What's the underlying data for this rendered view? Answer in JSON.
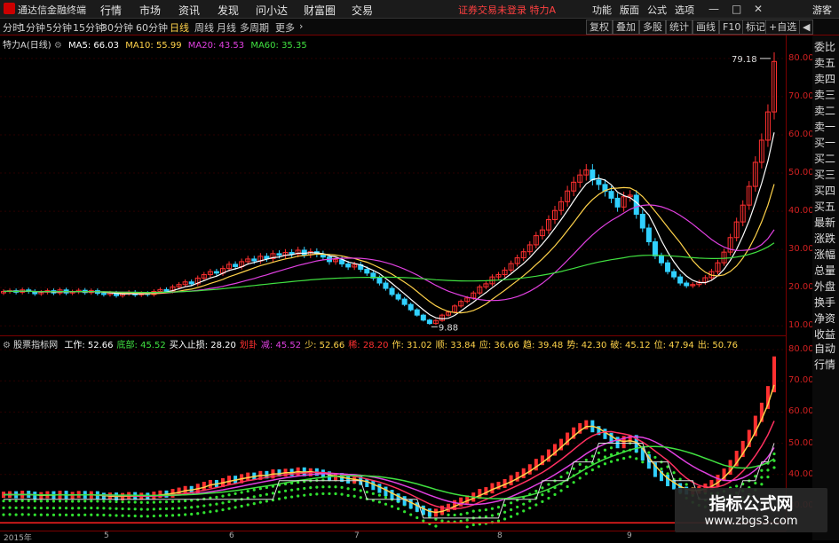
{
  "titlebar": {
    "app_title": "通达信金融终端",
    "menus": [
      "行情",
      "市场",
      "资讯",
      "发现",
      "问小达",
      "财富圈",
      "交易"
    ],
    "status": "证券交易未登录  特力A",
    "right_menus": [
      "功能",
      "版面",
      "公式",
      "选项"
    ],
    "guest": "游客",
    "min": "—",
    "max": "□",
    "close": "✕"
  },
  "toolbar": {
    "periods": [
      "分时",
      "1分钟",
      "5分钟",
      "15分钟",
      "30分钟",
      "60分钟",
      "日线",
      "周线",
      "月线",
      "多周期",
      "更多"
    ],
    "active_period": "日线",
    "right_tools": [
      "复权",
      "叠加",
      "多股",
      "统计",
      "画线",
      "F10",
      "标记",
      "+自选",
      "◀"
    ]
  },
  "main_chart": {
    "stock": "特力A",
    "period_tag": "(日线)",
    "ma": [
      {
        "label": "MA5: 66.03",
        "color": "#ffffff"
      },
      {
        "label": "MA10: 55.99",
        "color": "#ffd24a"
      },
      {
        "label": "MA20: 43.53",
        "color": "#e040e0"
      },
      {
        "label": "MA60: 35.35",
        "color": "#40e040"
      }
    ],
    "high_label": "79.18",
    "low_label": "9.88",
    "yticks": [
      "80.00",
      "70.00",
      "60.00",
      "50.00",
      "40.00",
      "30.00",
      "20.00",
      "10.00"
    ],
    "ylim": [
      7.5,
      86
    ]
  },
  "sub_chart": {
    "title": "股票指标网",
    "items": [
      {
        "label": "工作: 52.66",
        "color": "#ffffff"
      },
      {
        "label": "底部: 45.52",
        "color": "#40e040"
      },
      {
        "label": "买入止损: 28.20",
        "color": "#ffffff"
      },
      {
        "label": "划卦",
        "color": "#ff3030"
      },
      {
        "label": "减: 45.52",
        "color": "#e040e0"
      },
      {
        "label": "少: 52.66",
        "color": "#ffd24a"
      },
      {
        "label": "稀: 28.20",
        "color": "#ff3030"
      },
      {
        "label": "作: 31.02",
        "color": "#ffd24a"
      },
      {
        "label": "顺: 33.84",
        "color": "#ffd24a"
      },
      {
        "label": "应: 36.66",
        "color": "#ffd24a"
      },
      {
        "label": "趋: 39.48",
        "color": "#ffd24a"
      },
      {
        "label": "势: 42.30",
        "color": "#ffd24a"
      },
      {
        "label": "破: 45.12",
        "color": "#ffd24a"
      },
      {
        "label": "位: 47.94",
        "color": "#ffd24a"
      },
      {
        "label": "出: 50.76",
        "color": "#ffd24a"
      }
    ],
    "yticks": [
      "80.00",
      "70.00",
      "60.00",
      "50.00",
      "40.00",
      "30.00"
    ],
    "ylim": [
      22,
      84
    ]
  },
  "xaxis": {
    "labels": [
      "2015年",
      "5",
      "6",
      "7",
      "8",
      "9"
    ]
  },
  "sidebar": [
    "委比",
    "卖五",
    "卖四",
    "卖三",
    "卖二",
    "卖一",
    "买一",
    "买二",
    "买三",
    "买四",
    "买五",
    "最新",
    "涨跌",
    "涨幅",
    "总量",
    "外盘",
    "换手",
    "净资",
    "收益",
    "自动",
    "行情"
  ],
  "watermark": {
    "title": "指标公式网",
    "url": "www.zbgs3.com"
  },
  "chart_data": {
    "type": "candlestick",
    "title": "特力A (日线)",
    "ylim": [
      7.5,
      86
    ],
    "series_close": [
      19,
      19.2,
      18.8,
      19.4,
      19,
      18.4,
      18.8,
      19.2,
      18.6,
      19.4,
      18.6,
      18.9,
      19.3,
      18.7,
      19.2,
      18.5,
      18.2,
      18.6,
      17.9,
      18.4,
      18.8,
      18.1,
      18.5,
      18.2,
      19,
      19.5,
      19.1,
      20.2,
      20.8,
      21.5,
      21,
      22.5,
      23.4,
      24.2,
      23.8,
      25,
      26.1,
      25.5,
      26.8,
      27.5,
      27,
      28.2,
      27.6,
      28.9,
      28.5,
      29.2,
      28.8,
      29.8,
      28.6,
      29.4,
      28.8,
      28,
      26.8,
      27.3,
      26.2,
      25.4,
      26,
      24.8,
      23.8,
      22.5,
      21.2,
      19.8,
      18.2,
      17,
      15.6,
      14.2,
      12.8,
      11.5,
      10.6,
      11.4,
      12.8,
      13.6,
      15.2,
      16.4,
      17.3,
      18.6,
      20.2,
      21,
      22.8,
      23.4,
      24.6,
      26.3,
      27.8,
      29.4,
      31.2,
      33.6,
      35.1,
      37.8,
      40.2,
      42.5,
      45.3,
      47.6,
      49.5,
      50.8,
      48.2,
      47,
      45.2,
      43.4,
      41.1,
      43.8,
      44.2,
      39.2,
      35.6,
      32,
      28.3,
      26.5,
      24.2,
      22.8,
      21.2,
      20.5,
      20.8,
      21.4,
      22.6,
      24.2,
      26.5,
      29.3,
      33.1,
      37.2,
      41.6,
      46.5,
      52.8,
      58.6,
      66.0,
      79.2
    ],
    "ma5_last": 66.03,
    "ma10_last": 55.99,
    "ma20_last": 43.53,
    "ma60_last": 35.35,
    "annotations": [
      "79.18",
      "9.88"
    ],
    "sub_lines": [
      "工作",
      "底部",
      "减",
      "少"
    ],
    "sub_last": [
      52.66,
      45.52,
      45.52,
      52.66
    ]
  }
}
